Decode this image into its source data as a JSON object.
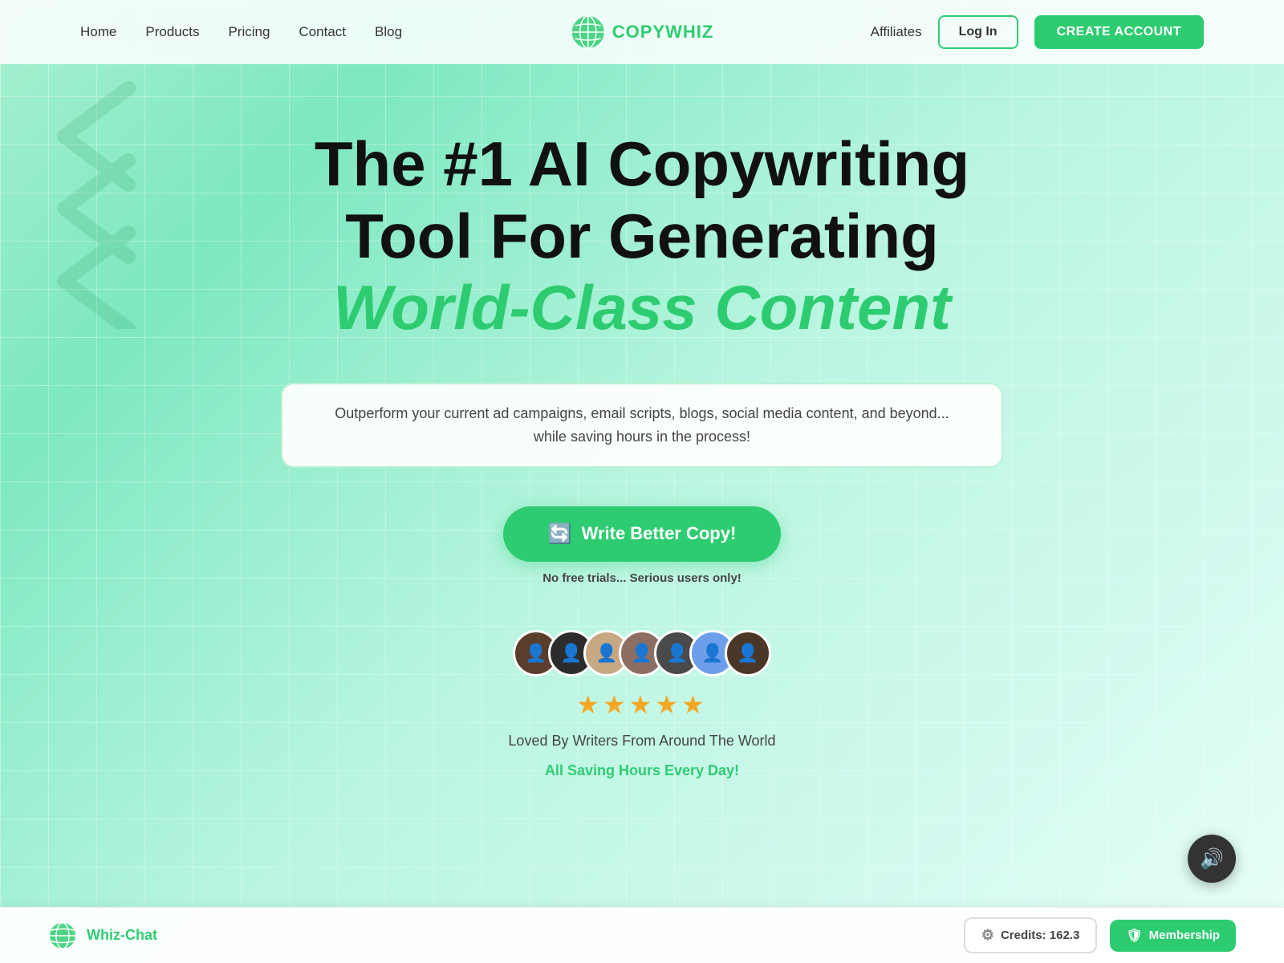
{
  "nav": {
    "links": [
      {
        "label": "Home",
        "id": "home"
      },
      {
        "label": "Products",
        "id": "products"
      },
      {
        "label": "Pricing",
        "id": "pricing"
      },
      {
        "label": "Contact",
        "id": "contact"
      },
      {
        "label": "Blog",
        "id": "blog"
      }
    ],
    "logo_text_1": "COPY",
    "logo_text_2": "WHIZ",
    "nav_right_links": [
      {
        "label": "Affiliates",
        "id": "affiliates"
      }
    ],
    "login_label": "Log In",
    "create_account_label": "CREATE ACCOUNT"
  },
  "hero": {
    "title_line1": "The #1 AI Copywriting",
    "title_line2": "Tool For Generating",
    "title_highlight": "World-Class Content",
    "subtitle": "Outperform your current ad campaigns, email scripts, blogs, social media content, and beyond... while saving hours in the process!",
    "cta_button": "Write Better Copy!",
    "cta_note": "No free trials... Serious users only!",
    "loved_text": "Loved By Writers From Around The World",
    "saving_text": "All Saving Hours Every Day!"
  },
  "bottom_bar": {
    "whiz_chat_label": "Whiz-Chat",
    "credits_label": "Credits: 162.3",
    "membership_label": "Membership"
  },
  "sound_button": {
    "label": "sound"
  }
}
